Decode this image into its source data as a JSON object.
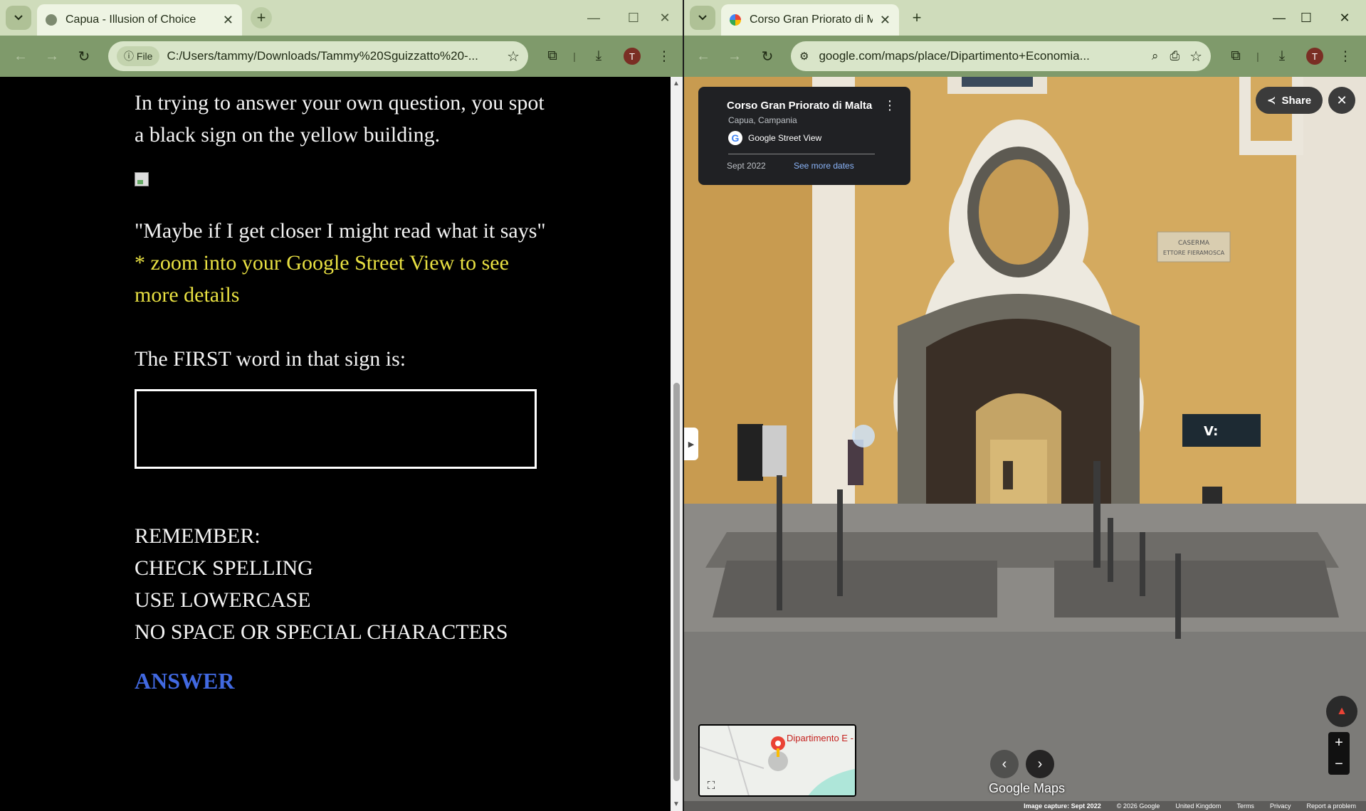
{
  "left_window": {
    "tab_title": "Capua - Illusion of Choice",
    "chip_label": "File",
    "url": "C:/Users/tammy/Downloads/Tammy%20Sguizzatto%20-...",
    "avatar_initial": "T",
    "story": {
      "intro": "In trying to answer your own question, you spot a black sign on the yellow building.",
      "quote": "\"Maybe if I get closer I might read what it says\"",
      "hint": "* zoom into your Google Street View to see more details",
      "question": "The FIRST word in that sign is:",
      "answer_value": "",
      "remember_heading": "REMEMBER:",
      "rule_1": "CHECK SPELLING",
      "rule_2": "USE LOWERCASE",
      "rule_3": "NO SPACE OR SPECIAL CHARACTERS",
      "answer_link": "ANSWER"
    },
    "colors": {
      "hint": "#e8e042",
      "answer_link": "#4169e1",
      "background": "#000000"
    }
  },
  "right_window": {
    "tab_title": "Corso Gran Priorato di Malta - G",
    "url": "google.com/maps/place/Dipartimento+Economia...",
    "avatar_initial": "T",
    "info_card": {
      "place_name": "Corso Gran Priorato di Malta",
      "region": "Capua, Campania",
      "source": "Google Street View",
      "capture_date": "Sept 2022",
      "see_more": "See more dates"
    },
    "share_label": "Share",
    "minimap_label": "Dipartimento E - Università deg",
    "logo_text": "Google Maps",
    "footer": {
      "capture": "Image capture: Sept 2022",
      "copyright": "© 2026 Google",
      "region": "United Kingdom",
      "terms": "Terms",
      "privacy": "Privacy",
      "report": "Report a problem"
    },
    "signs": {
      "plaque_line1": "CASERMA",
      "plaque_line2": "ETTORE FIERAMOSCA",
      "black_sign_logo": "V:"
    }
  }
}
